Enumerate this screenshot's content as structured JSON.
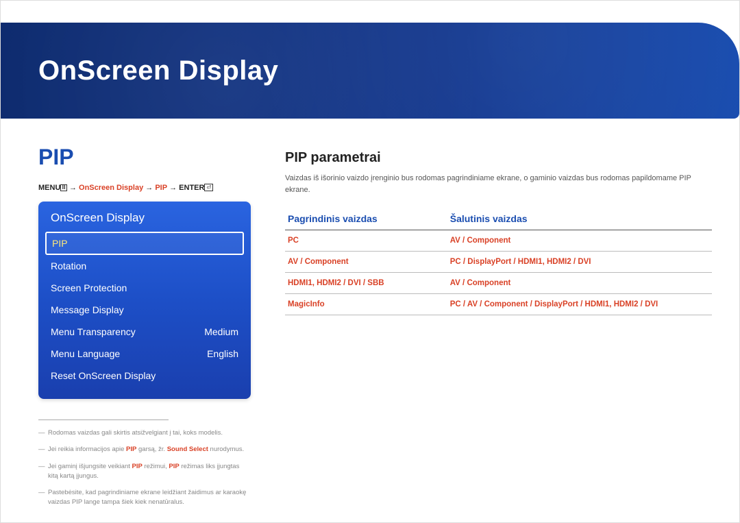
{
  "header": {
    "title": "OnScreen Display"
  },
  "left": {
    "heading": "PIP",
    "breadcrumb": {
      "menu": "MENU",
      "path1": "OnScreen Display",
      "path2": "PIP",
      "enter": "ENTER",
      "arrow": "→"
    },
    "osd": {
      "title": "OnScreen Display",
      "items": [
        {
          "label": "PIP",
          "value": ""
        },
        {
          "label": "Rotation",
          "value": ""
        },
        {
          "label": "Screen Protection",
          "value": ""
        },
        {
          "label": "Message Display",
          "value": ""
        },
        {
          "label": "Menu Transparency",
          "value": "Medium"
        },
        {
          "label": "Menu Language",
          "value": "English"
        },
        {
          "label": "Reset OnScreen Display",
          "value": ""
        }
      ]
    },
    "footnotes": {
      "n1": "Rodomas vaizdas gali skirtis atsižvelgiant į tai, koks modelis.",
      "n2a": "Jei reikia informacijos apie ",
      "n2b": " garsą, žr. ",
      "n2c": " nurodymus.",
      "n2_hl1": "PIP",
      "n2_hl2": "Sound Select",
      "n3a": "Jei gaminį išjungsite veikiant ",
      "n3b": " režimui, ",
      "n3c": " režimas liks įjungtas kitą kartą įjungus.",
      "n3_hl1": "PIP",
      "n3_hl2": "PIP",
      "n4": "Pastebėsite, kad pagrindiniame ekrane leidžiant žaidimus ar karaokę vaizdas PIP lange tampa šiek kiek nenatūralus."
    }
  },
  "right": {
    "section_title": "PIP parametrai",
    "desc": "Vaizdas iš išorinio vaizdo įrenginio bus rodomas pagrindiniame ekrane, o gaminio vaizdas bus rodomas papildomame PIP ekrane.",
    "table": {
      "col1": "Pagrindinis vaizdas",
      "col2": "Šalutinis vaizdas",
      "rows": [
        {
          "main": "PC",
          "sub": "AV / Component"
        },
        {
          "main": "AV / Component",
          "sub": "PC / DisplayPort / HDMI1, HDMI2 / DVI"
        },
        {
          "main": "HDMI1, HDMI2 / DVI / SBB",
          "sub": "AV / Component"
        },
        {
          "main": "MagicInfo",
          "sub": "PC / AV / Component / DisplayPort / HDMI1, HDMI2 / DVI"
        }
      ]
    }
  }
}
